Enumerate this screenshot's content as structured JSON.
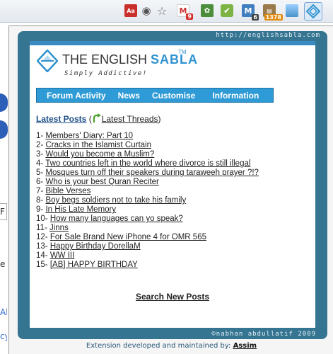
{
  "toolbar": {
    "icons": [
      {
        "name": "dictionary-icon",
        "glyph": "Aa"
      },
      {
        "name": "bulb-icon",
        "glyph": "◉"
      },
      {
        "name": "star-icon",
        "glyph": "☆"
      },
      {
        "name": "gmail-icon",
        "glyph": "M",
        "badge": "9"
      },
      {
        "name": "puzzle-icon",
        "glyph": "✿"
      },
      {
        "name": "feedly-icon",
        "glyph": "✔"
      },
      {
        "name": "m-icon",
        "glyph": "M",
        "badge": "6"
      },
      {
        "name": "reader-icon",
        "glyph": "▤",
        "badge": "1378"
      },
      {
        "name": "picture-icon",
        "glyph": ""
      },
      {
        "name": "english-sabla-icon",
        "glyph": ""
      }
    ]
  },
  "background": {
    "field_char": "F",
    "letter_e": "e",
    "letter_ab": "Ab",
    "letter_cy": "cy"
  },
  "popup": {
    "url_text": "http://englishsabla.com",
    "copyright": "©nabhan abdullatif 2009",
    "logo": {
      "name_plain": "THE ENGLISH ",
      "name_accent": "SABLA",
      "tm": "TM",
      "tagline": "Simply Addictive!"
    },
    "nav": {
      "forum_activity": "Forum Activity",
      "news": "News",
      "customise": "Customise",
      "information": "Information"
    },
    "latest": {
      "title": "Latest Posts",
      "open_paren": "(",
      "threads_label": "Latest Threads",
      "close_paren": ")"
    },
    "posts": [
      {
        "num": "1-",
        "title": "Members' Diary: Part 10"
      },
      {
        "num": "2-",
        "title": "Cracks in the Islamist Curtain"
      },
      {
        "num": "3-",
        "title": "Would you become a Muslim?"
      },
      {
        "num": "4-",
        "title": "Two countries left in the world where divorce is still illegal"
      },
      {
        "num": "5-",
        "title": "Mosques turn off their speakers during taraweeh prayer ?!?"
      },
      {
        "num": "6-",
        "title": "Who is your best Quran Reciter"
      },
      {
        "num": "7-",
        "title": "Bible Verses"
      },
      {
        "num": "8-",
        "title": "Boy begs soldiers not to take his family"
      },
      {
        "num": "9-",
        "title": "In His Late Memory"
      },
      {
        "num": "10-",
        "title": "How many languages can yo speak?"
      },
      {
        "num": "11-",
        "title": "Jinns"
      },
      {
        "num": "12-",
        "title": "For Sale Brand New iPhone 4 for OMR 565"
      },
      {
        "num": "13-",
        "title": "Happy Birthday DorellaM"
      },
      {
        "num": "14-",
        "title": "WW III"
      },
      {
        "num": "15-",
        "title": "[AB] HAPPY BIRTHDAY"
      }
    ],
    "search_new_posts": "Search New Posts",
    "footer": {
      "text": "Extension developed and maintained by: ",
      "author": "Assim"
    }
  },
  "colors": {
    "frame": "#357592",
    "nav": "#2f9bd6",
    "accent": "#2f93cf",
    "title_link": "#1f4f88"
  }
}
